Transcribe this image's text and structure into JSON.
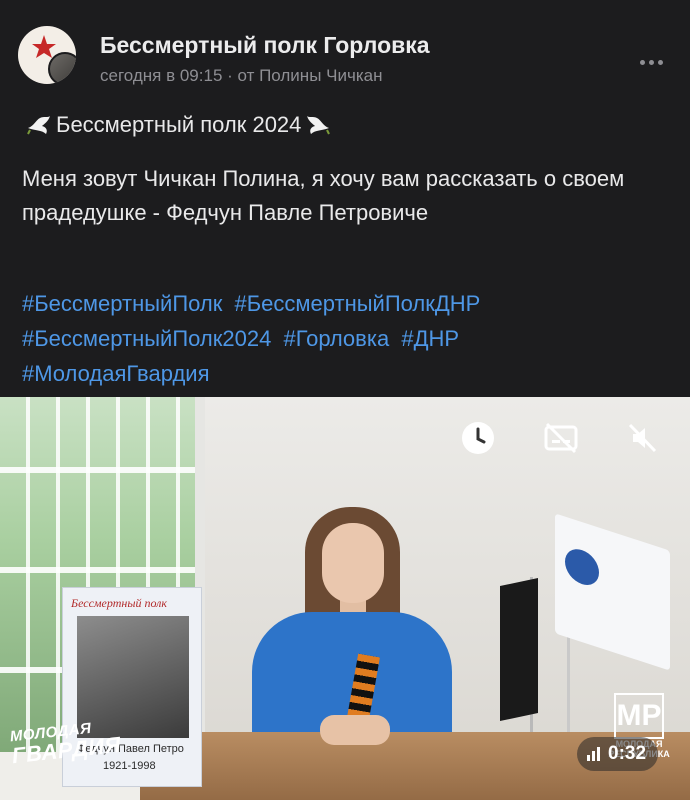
{
  "post": {
    "community_name": "Бессмертный полк Горловка",
    "meta": "сегодня в 09:15 · от Полины Чичкан",
    "more_icon": "more-horizontal-icon",
    "heading": "Бессмертный полк 2024",
    "heading_icon": "dove-icon",
    "body": "Меня зовут Чичкан Полина, я хочу вам рассказать о своем прадедушке - Федчун Павле Петровиче",
    "hashtags": [
      "#БессмертныйПолк",
      "#БессмертныйПолкДНР",
      "#БессмертныйПолк2024",
      "#Горловка",
      "#ДНР",
      "#МолодаяГвардия"
    ]
  },
  "video": {
    "controls": {
      "watch_later_icon": "clock-icon",
      "subtitles_icon": "subtitles-off-icon",
      "mute_icon": "volume-off-icon"
    },
    "duration": "0:32",
    "badge_left_line1": "МОЛОДАЯ",
    "badge_left_line2": "ГВАРДИЯ",
    "badge_right_mark": "МР",
    "badge_right_caption_1": "МОЛОДАЯ",
    "badge_right_caption_2": "РЕСПУБЛИКА",
    "portrait_header": "Бессмертный полк",
    "portrait_name": "Федчун Павел Петро",
    "portrait_years": "1921-1998"
  },
  "colors": {
    "background": "#1c1c1e",
    "text": "#e9e9ea",
    "secondary": "#8e8e93",
    "link": "#4e97e6"
  }
}
